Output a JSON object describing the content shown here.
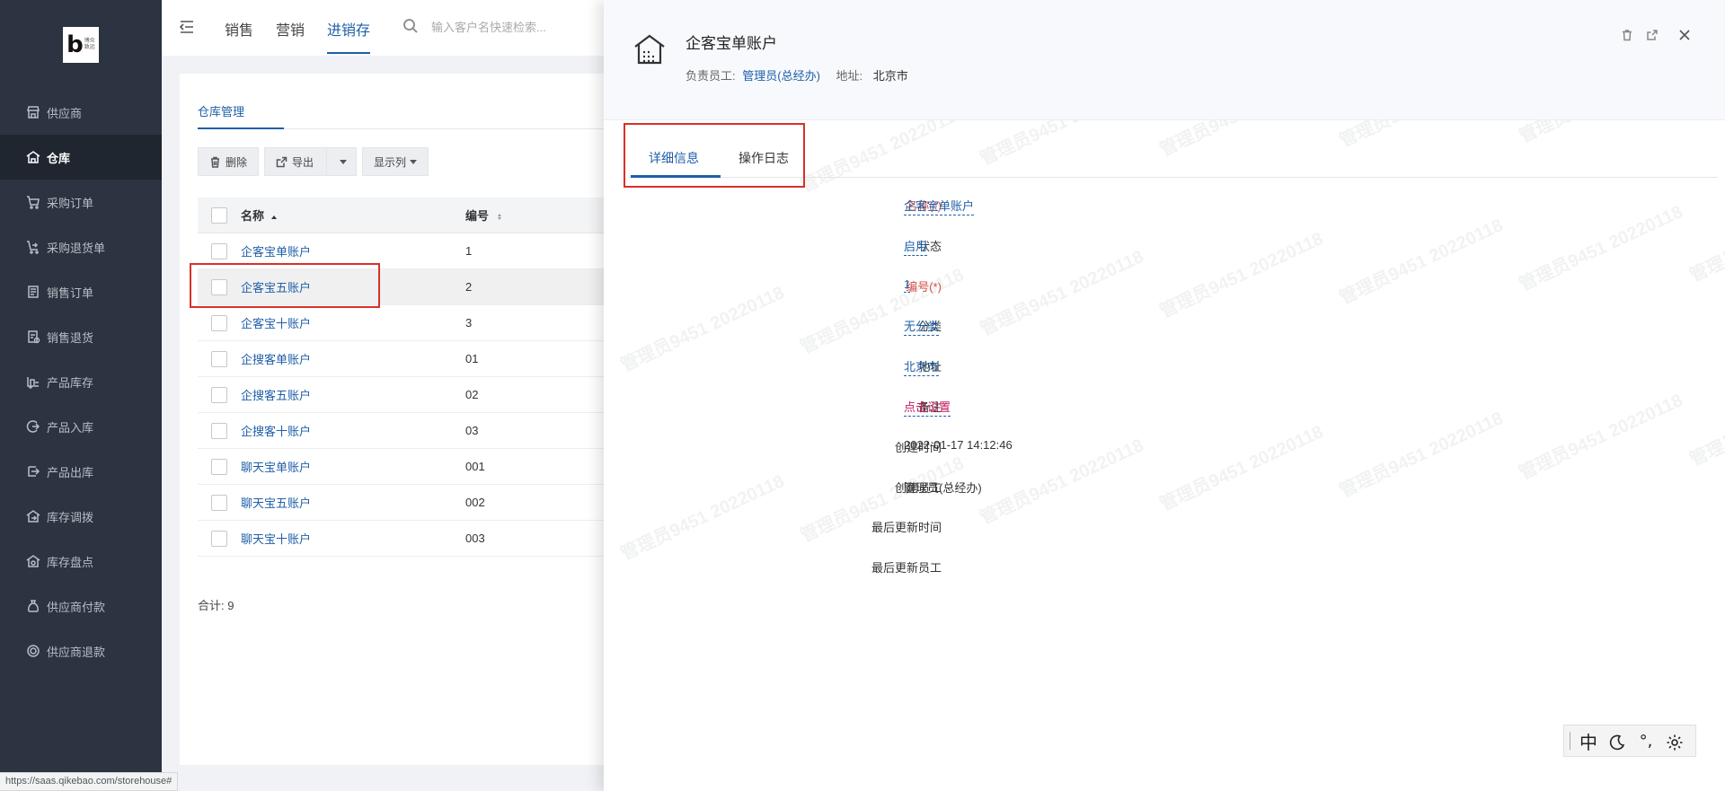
{
  "sidebar": {
    "logo_mark": "b",
    "logo_line1": "博众",
    "logo_line2": "致远",
    "items": [
      {
        "label": "供应商",
        "icon": "store-icon"
      },
      {
        "label": "仓库",
        "icon": "warehouse-icon",
        "active": true
      },
      {
        "label": "采购订单",
        "icon": "cart-icon"
      },
      {
        "label": "采购退货单",
        "icon": "cart-return-icon"
      },
      {
        "label": "销售订单",
        "icon": "order-list-icon"
      },
      {
        "label": "销售退货",
        "icon": "return-doc-icon"
      },
      {
        "label": "产品库存",
        "icon": "forklift-icon"
      },
      {
        "label": "产品入库",
        "icon": "inbound-icon"
      },
      {
        "label": "产品出库",
        "icon": "outbound-icon"
      },
      {
        "label": "库存调拨",
        "icon": "transfer-icon"
      },
      {
        "label": "库存盘点",
        "icon": "inventory-check-icon"
      },
      {
        "label": "供应商付款",
        "icon": "money-bag-icon"
      },
      {
        "label": "供应商退款",
        "icon": "refund-icon"
      }
    ]
  },
  "topnav": {
    "links": [
      "销售",
      "营销",
      "进销存"
    ],
    "active_index": 2,
    "search_placeholder": "输入客户名快速检索..."
  },
  "content": {
    "tab": "仓库管理",
    "toolbar": {
      "delete": "删除",
      "export": "导出",
      "columns": "显示列"
    },
    "columns": {
      "name": "名称",
      "code": "编号"
    },
    "rows": [
      {
        "name": "企客宝单账户",
        "code": "1"
      },
      {
        "name": "企客宝五账户",
        "code": "2"
      },
      {
        "name": "企客宝十账户",
        "code": "3"
      },
      {
        "name": "企搜客单账户",
        "code": "01"
      },
      {
        "name": "企搜客五账户",
        "code": "02"
      },
      {
        "name": "企搜客十账户",
        "code": "03"
      },
      {
        "name": "聊天宝单账户",
        "code": "001"
      },
      {
        "name": "聊天宝五账户",
        "code": "002"
      },
      {
        "name": "聊天宝十账户",
        "code": "003"
      }
    ],
    "total_label": "合计:",
    "total_value": "9"
  },
  "statusbar": {
    "url": "https://saas.qikebao.com/storehouse#"
  },
  "drawer": {
    "title": "企客宝单账户",
    "owner_label": "负责员工:",
    "owner_value": "管理员(总经办)",
    "address_label": "地址:",
    "address_value": "北京市",
    "tabs": [
      "详细信息",
      "操作日志"
    ],
    "fields": [
      {
        "label": "名称(*)",
        "value": "企客宝单账户",
        "required": true,
        "style": "link"
      },
      {
        "label": "状态",
        "value": "启用",
        "style": "link"
      },
      {
        "label": "编号(*)",
        "value": "1",
        "required": true,
        "style": "link"
      },
      {
        "label": "分类",
        "value": "无分类",
        "style": "link"
      },
      {
        "label": "地址",
        "value": "北京市",
        "style": "link"
      },
      {
        "label": "备注",
        "value": "点击设置",
        "style": "set"
      },
      {
        "label": "创建时间",
        "value": "2022-01-17 14:12:46",
        "style": "plain"
      },
      {
        "label": "创建员工",
        "value": "管理员(总经办)",
        "style": "plain"
      },
      {
        "label": "最后更新时间",
        "value": "",
        "style": "plain"
      },
      {
        "label": "最后更新员工",
        "value": "",
        "style": "plain"
      }
    ],
    "watermark": "管理员9451 20220118"
  },
  "floattool": {
    "lang": "中",
    "punct": "°,"
  },
  "colors": {
    "accent": "#1f5fa8",
    "sidebar": "#2b3440",
    "highlight": "#d9302a",
    "required": "#d44c47"
  }
}
